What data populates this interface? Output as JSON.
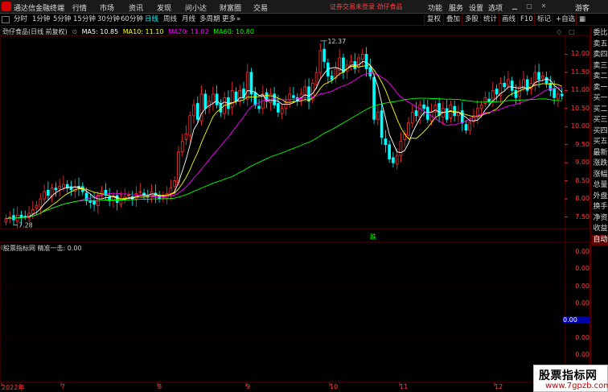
{
  "menubar": {
    "app_title": "通达信金融终端",
    "items": [
      "行情",
      "市场",
      "资讯",
      "发现",
      "问小达",
      "财富圈",
      "交易"
    ],
    "notice": "证券交易未登录  劲仔食品",
    "right_items": [
      "功能",
      "服务",
      "设置",
      "选项"
    ],
    "guest": "游客"
  },
  "toolbar": {
    "periods": [
      "分时",
      "1分钟",
      "5分钟",
      "15分钟",
      "30分钟",
      "60分钟",
      "日线",
      "周线",
      "月线",
      "多周期",
      "更多"
    ],
    "active_period": "日线",
    "right_buttons": [
      "复权",
      "叠加",
      "多股",
      "统计",
      "画线",
      "F10",
      "标记",
      "+自选"
    ]
  },
  "stock": {
    "name_label": "劲仔食品(日线 前复权)",
    "ma5": "MA5: 10.85",
    "ma10": "MA10: 11.10",
    "ma20": "MA20: 11.02",
    "ma60": "MA60: 10.80",
    "high_mark": "12.37",
    "low_mark": "7.28",
    "die_mark": "跌"
  },
  "indicator": {
    "title": "股票指标网  精准一击: 0.00",
    "y_labels": [
      "0.00",
      "0.00",
      "0.00",
      "0.00",
      "0.00",
      "0.00",
      "0.00",
      "0.00"
    ]
  },
  "right_panel": [
    "委比",
    "卖五",
    "卖四",
    "卖三",
    "卖二",
    "卖一",
    "买一",
    "买二",
    "买三",
    "买四",
    "买五",
    "最新",
    "涨跌",
    "涨幅",
    "总量",
    "外盘",
    "换手",
    "净资",
    "收益",
    "自动"
  ],
  "colors": {
    "up": "#ff3232",
    "down": "#00ffff",
    "ma5": "#ffffff",
    "ma10": "#ffff00",
    "ma20": "#ff00ff",
    "ma60": "#00ff00"
  },
  "chart_data": {
    "type": "candlestick",
    "y_labels": [
      "12.00",
      "11.50",
      "11.00",
      "10.50",
      "10.00",
      "9.50",
      "9.00",
      "8.50",
      "8.00",
      "7.50"
    ],
    "ylim": [
      7.2,
      12.5
    ],
    "x_labels": [
      "2022年",
      "7",
      "8",
      "9",
      "10",
      "11",
      "12"
    ],
    "close": [
      7.45,
      7.5,
      7.42,
      7.55,
      7.48,
      7.52,
      7.6,
      7.7,
      7.82,
      8.0,
      8.2,
      8.1,
      8.3,
      8.25,
      8.35,
      8.4,
      8.3,
      8.25,
      8.35,
      8.3,
      8.2,
      7.95,
      7.9,
      7.85,
      8.1,
      8.2,
      8.1,
      7.95,
      8.05,
      7.9,
      8.0,
      8.05,
      8.1,
      8.0,
      8.15,
      8.2,
      8.1,
      8.05,
      8.2,
      8.1,
      8.0,
      8.05,
      8.15,
      8.3,
      8.5,
      9.3,
      9.6,
      9.8,
      10.3,
      10.6,
      10.2,
      10.9,
      10.5,
      10.7,
      10.9,
      10.6,
      10.4,
      10.8,
      10.5,
      11.0,
      10.7,
      11.0,
      10.8,
      11.5,
      10.9,
      10.6,
      10.5,
      10.9,
      10.7,
      10.9,
      10.6,
      10.4,
      10.5,
      10.7,
      10.9,
      10.8,
      10.7,
      10.9,
      11.1,
      10.7,
      11.2,
      11.5,
      12.1,
      11.8,
      11.4,
      11.3,
      11.6,
      11.9,
      11.5,
      11.7,
      11.8,
      11.6,
      11.9,
      12.0,
      11.6,
      11.4,
      10.2,
      10.4,
      9.7,
      9.5,
      9.1,
      9.0,
      9.2,
      9.6,
      9.8,
      10.1,
      10.4,
      10.3,
      10.6,
      10.5,
      10.2,
      10.4,
      10.6,
      10.3,
      10.5,
      10.2,
      10.6,
      10.3,
      10.4,
      10.1,
      9.9,
      10.1,
      10.3,
      10.5,
      10.6,
      10.8,
      10.7,
      11.0,
      10.9,
      11.2,
      11.1,
      11.3,
      11.0,
      10.8,
      11.1,
      11.3,
      11.0,
      11.2,
      11.5,
      11.3,
      11.4,
      11.2,
      11.0,
      10.8,
      10.9,
      10.85
    ],
    "ma60_label": "MA60: 10.80"
  }
}
